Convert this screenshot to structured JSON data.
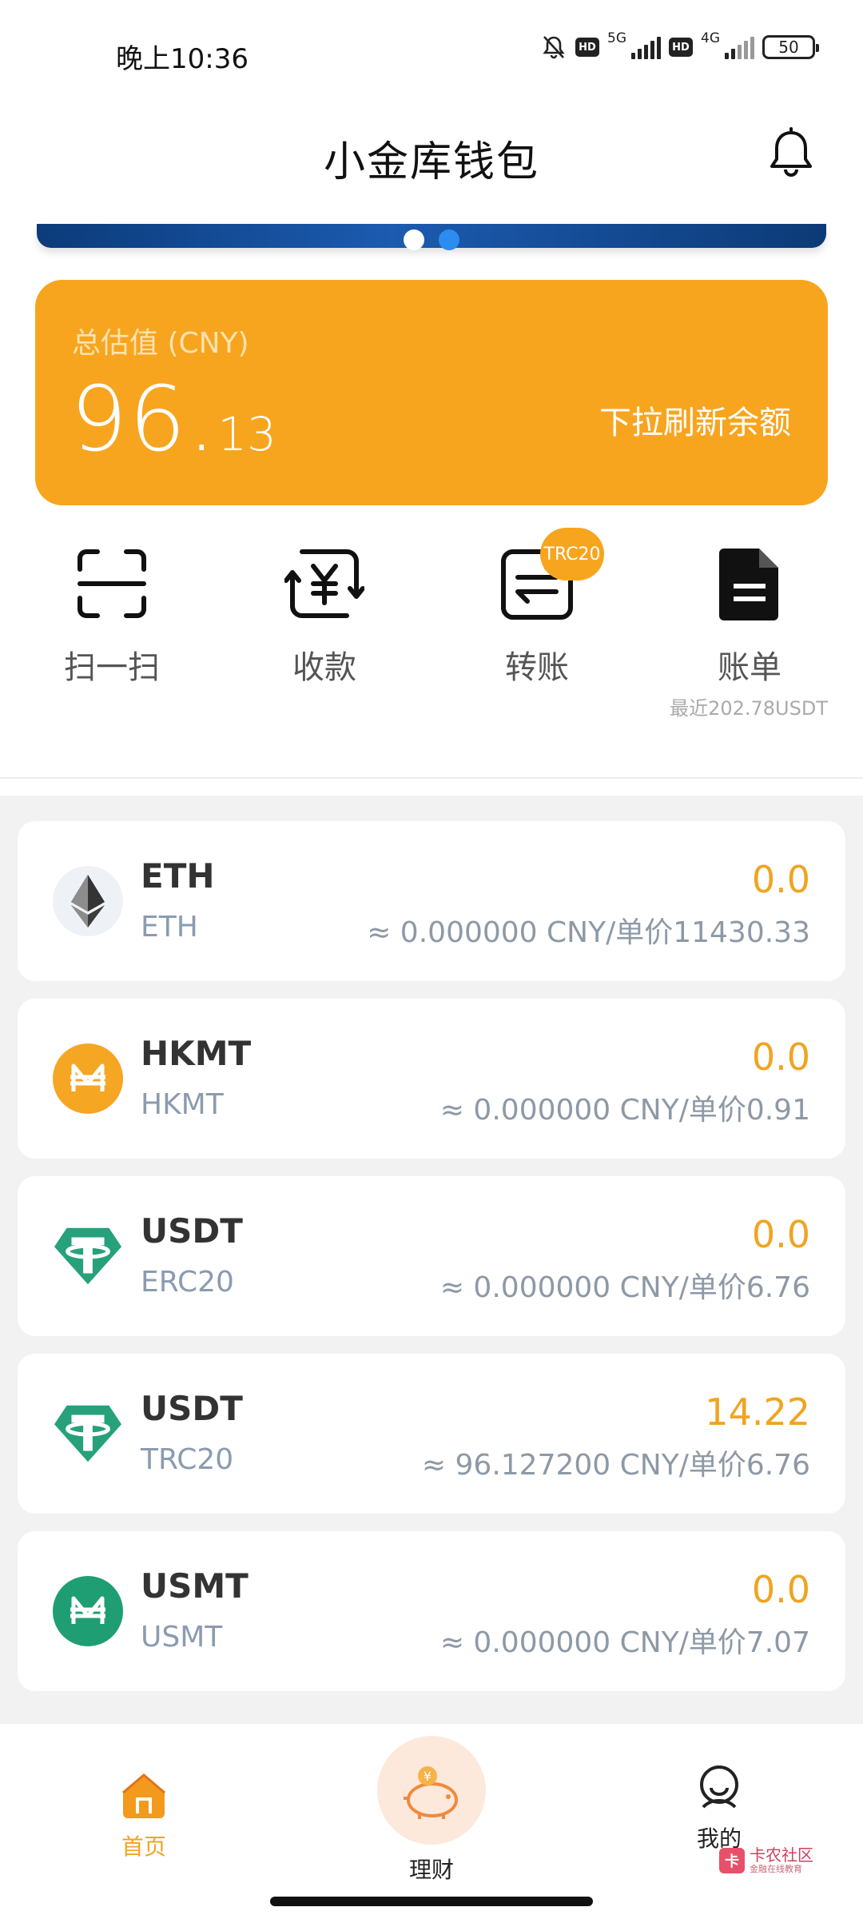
{
  "status_bar": {
    "time": "晚上10:36",
    "hd1": "HD",
    "net1": "5G",
    "hd2": "HD",
    "net2": "4G",
    "battery": "50"
  },
  "header": {
    "title": "小金库钱包"
  },
  "balance": {
    "label": "总估值 (CNY)",
    "integer": "96.",
    "decimal": "13",
    "refresh_hint": "下拉刷新余额"
  },
  "actions": [
    {
      "label": "扫一扫"
    },
    {
      "label": "收款"
    },
    {
      "label": "转账",
      "badge": "TRC20"
    },
    {
      "label": "账单",
      "note": "最近202.78USDT"
    }
  ],
  "assets": [
    {
      "name": "ETH",
      "sub": "ETH",
      "amount": "0.0",
      "value": "≈ 0.000000 CNY/单价11430.33",
      "icon": "eth-icon"
    },
    {
      "name": "HKMT",
      "sub": "HKMT",
      "amount": "0.0",
      "value": "≈ 0.000000 CNY/单价0.91",
      "icon": "hkmt-icon"
    },
    {
      "name": "USDT",
      "sub": "ERC20",
      "amount": "0.0",
      "value": "≈ 0.000000 CNY/单价6.76",
      "icon": "tether-icon"
    },
    {
      "name": "USDT",
      "sub": "TRC20",
      "amount": "14.22",
      "value": "≈ 96.127200 CNY/单价6.76",
      "icon": "tether-icon"
    },
    {
      "name": "USMT",
      "sub": "USMT",
      "amount": "0.0",
      "value": "≈ 0.000000 CNY/单价7.07",
      "icon": "usmt-icon"
    }
  ],
  "nav": {
    "home": "首页",
    "finance": "理财",
    "mine": "我的"
  },
  "watermark": {
    "title": "卡农社区",
    "sub": "金融在线教育"
  },
  "colors": {
    "accent": "#f7a51f",
    "amount": "#f0a422",
    "tether": "#26a17b",
    "hkmt": "#f5a623",
    "usmt": "#1f9e73"
  }
}
